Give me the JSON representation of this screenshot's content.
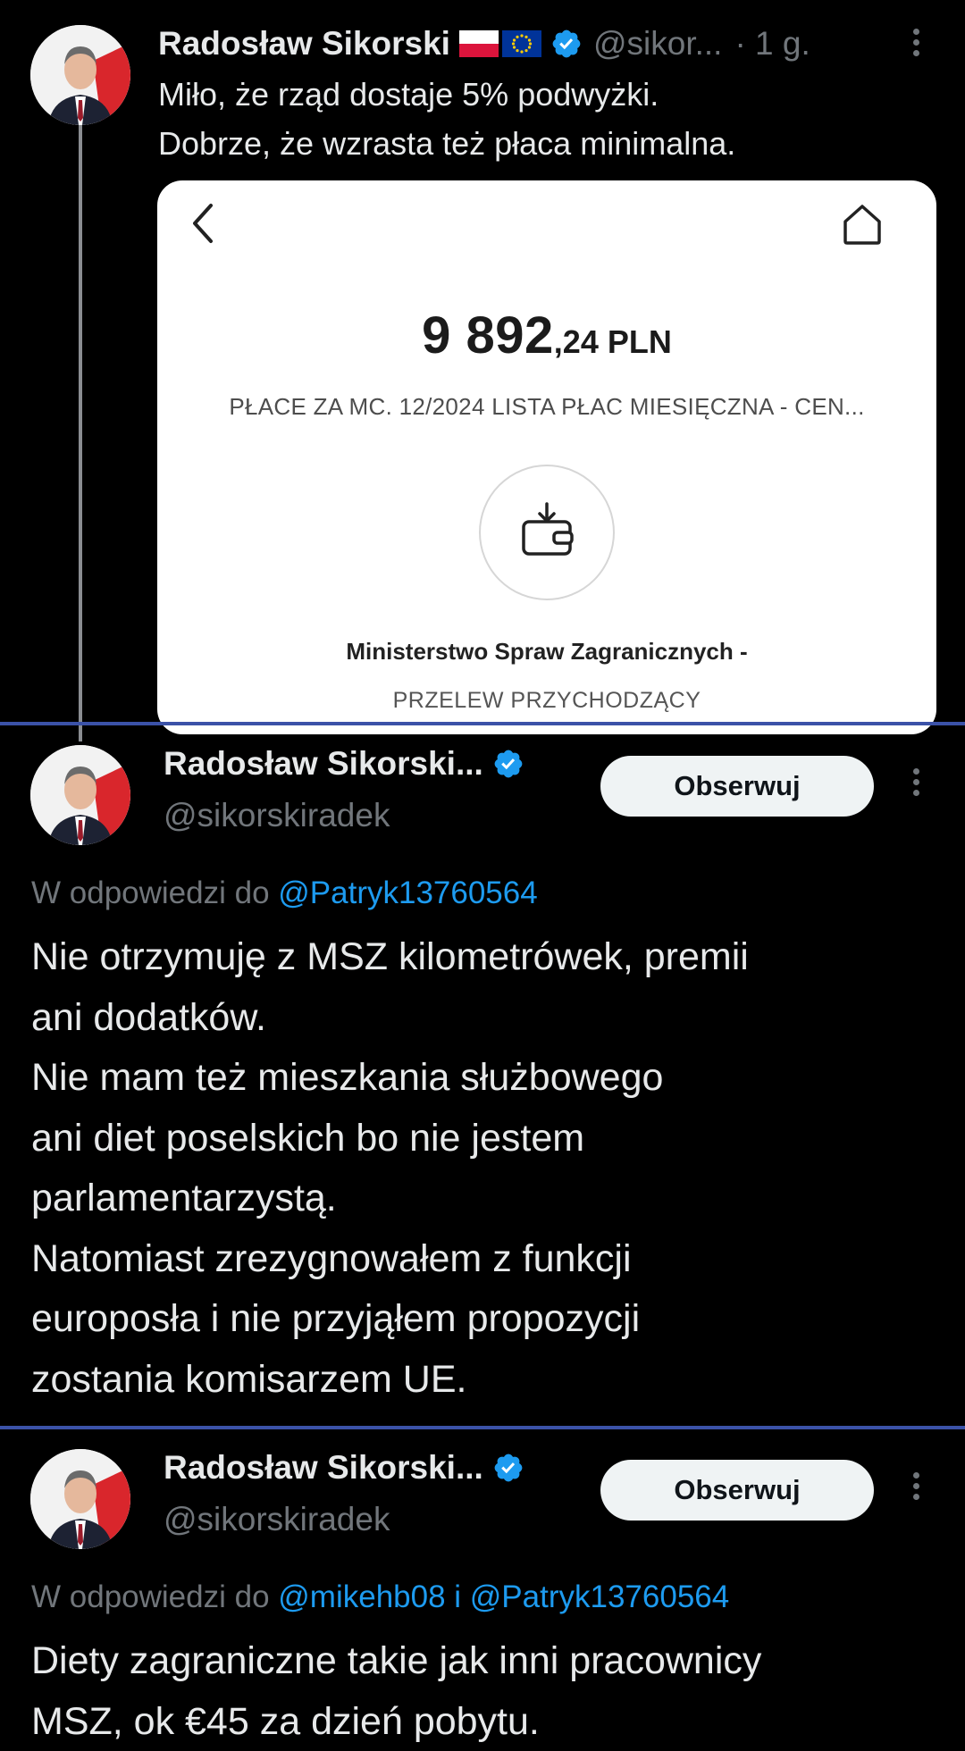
{
  "tweet1": {
    "author_name": "Radosław Sikorski",
    "handle": "@sikor...",
    "time": "· 1 g.",
    "text_lines": [
      "Miło, że rząd dostaje 5% podwyżki.",
      "Dobrze, że wzrasta też płaca minimalna."
    ],
    "card": {
      "amount_main": "9 892",
      "amount_decimal": ",24 PLN",
      "description": "PŁACE ZA MC. 12/2024 LISTA PŁAC MIESIĘCZNA - CEN...",
      "company": "Ministerstwo Spraw Zagranicznych -",
      "transfer_type": "PRZELEW PRZYCHODZĄCY"
    }
  },
  "tweet2": {
    "author_name": "Radosław Sikorski...",
    "handle": "@sikorskiradek",
    "follow_label": "Obserwuj",
    "reply_prefix": "W odpowiedzi do ",
    "reply_mentions": "@Patryk13760564",
    "body_lines": [
      "Nie otrzymuję z MSZ kilometrówek, premii",
      "ani dodatków.",
      "Nie mam też mieszkania służbowego",
      "ani diet poselskich bo nie jestem",
      "parlamentarzystą.",
      "Natomiast zrezygnowałem z funkcji",
      "europosła i nie przyjąłem propozycji",
      "zostania komisarzem UE."
    ]
  },
  "tweet3": {
    "author_name": "Radosław Sikorski...",
    "handle": "@sikorskiradek",
    "follow_label": "Obserwuj",
    "reply_prefix": "W odpowiedzi do ",
    "reply_mentions": "@mikehb08 i @Patryk13760564",
    "body_lines": [
      "Diety zagraniczne takie jak inni pracownicy",
      "MSZ, ok €45 za dzień pobytu."
    ]
  },
  "colors": {
    "background": "#000000",
    "text_primary": "#e7e9ea",
    "text_secondary": "#71767b",
    "link": "#1d9bf0",
    "verified": "#1d9bf0",
    "divider": "#3b52a8",
    "follow_button_bg": "#eff3f4"
  },
  "icons": [
    "poland-flag-icon",
    "eu-flag-icon",
    "verified-badge-icon",
    "more-options-icon",
    "back-arrow-icon",
    "home-icon",
    "wallet-download-icon"
  ]
}
